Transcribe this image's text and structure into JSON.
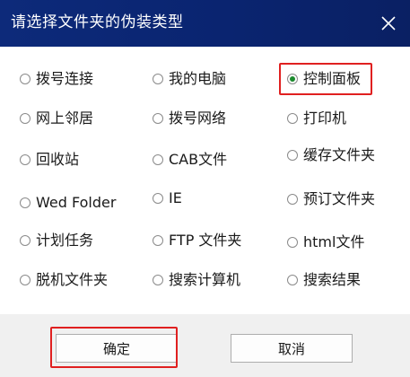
{
  "dialog": {
    "title": "请选择文件夹的伪装类型",
    "close_icon": "close-icon"
  },
  "options": [
    {
      "label": "拨号连接",
      "checked": false
    },
    {
      "label": "我的电脑",
      "checked": false
    },
    {
      "label": "控制面板",
      "checked": true
    },
    {
      "label": "网上邻居",
      "checked": false
    },
    {
      "label": "拨号网络",
      "checked": false
    },
    {
      "label": "打印机",
      "checked": false
    },
    {
      "label": "回收站",
      "checked": false
    },
    {
      "label": "CAB文件",
      "checked": false
    },
    {
      "label": "缓存文件夹",
      "checked": false
    },
    {
      "label": "Wed Folder",
      "checked": false
    },
    {
      "label": "IE",
      "checked": false
    },
    {
      "label": "预订文件夹",
      "checked": false
    },
    {
      "label": "计划任务",
      "checked": false
    },
    {
      "label": "FTP 文件夹",
      "checked": false
    },
    {
      "label": "html文件",
      "checked": false
    },
    {
      "label": "脱机文件夹",
      "checked": false
    },
    {
      "label": "搜索计算机",
      "checked": false
    },
    {
      "label": "搜索结果",
      "checked": false
    }
  ],
  "buttons": {
    "ok": "确定",
    "cancel": "取消"
  },
  "colors": {
    "titlebar": "#0d2a7a",
    "highlight": "#e02020",
    "radio_selected": "#1b8a2e"
  }
}
